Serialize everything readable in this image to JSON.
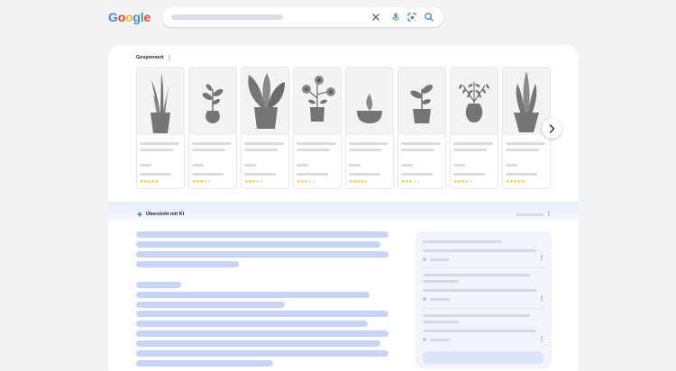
{
  "header": {
    "logo_letters": [
      {
        "char": "G",
        "color": "#4285f4"
      },
      {
        "char": "o",
        "color": "#ea4335"
      },
      {
        "char": "o",
        "color": "#fbbc05"
      },
      {
        "char": "g",
        "color": "#4285f4"
      },
      {
        "char": "l",
        "color": "#34a853"
      },
      {
        "char": "e",
        "color": "#ea4335"
      }
    ],
    "search": {
      "value": "",
      "icons": [
        "close-icon",
        "microphone-icon",
        "google-lens-icon",
        "search-icon"
      ]
    }
  },
  "shopping": {
    "label": "Gesponsert",
    "menu_icon": "more-vert-icon",
    "products": [
      {
        "plant": "tall-leaves",
        "rating": 5
      },
      {
        "plant": "small-sprout",
        "rating": 3.5
      },
      {
        "plant": "large-leaves",
        "rating": 3.5
      },
      {
        "plant": "flowers",
        "rating": 3
      },
      {
        "plant": "succulent",
        "rating": 4.5
      },
      {
        "plant": "sprout",
        "rating": 3
      },
      {
        "plant": "fern",
        "rating": 3.5
      },
      {
        "plant": "cactus",
        "rating": 5
      }
    ],
    "star_glyph": "★",
    "next_icon": "chevron-right-icon"
  },
  "ai_overview": {
    "title": "Übersicht mit KI",
    "icon": "sparkle-icon",
    "menu_icon": "more-vert-icon"
  },
  "colors": {
    "accent_blue": "#4285f4",
    "star_yellow": "#fbbc04",
    "plant_grey": "#757575",
    "skeleton_blue": "#c6d5f7",
    "skeleton_grey": "#dadce0"
  }
}
